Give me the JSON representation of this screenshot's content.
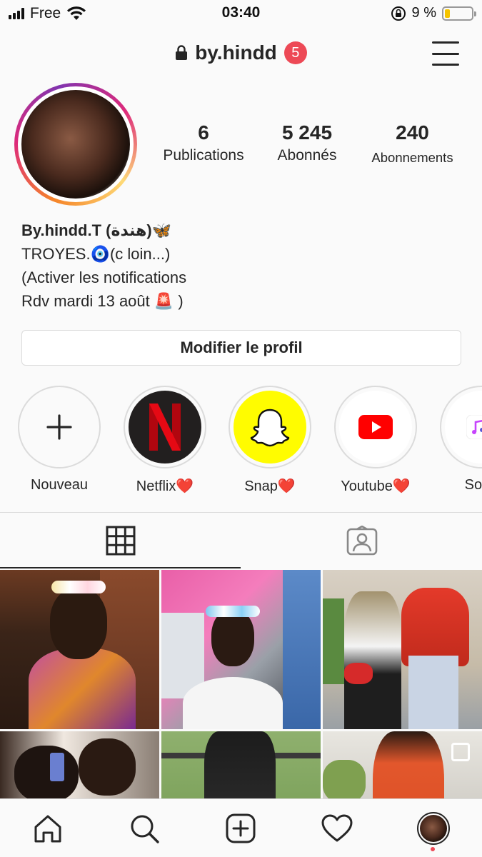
{
  "status_bar": {
    "carrier": "Free",
    "time": "03:40",
    "battery_percent": "9 %",
    "battery_level": 0.09,
    "icons": [
      "signal-icon",
      "wifi-icon",
      "rotation-lock-icon",
      "battery-icon"
    ]
  },
  "header": {
    "username": "by.hindd",
    "notification_count": "5",
    "icons": [
      "lock-icon",
      "menu-icon"
    ]
  },
  "profile": {
    "stats": [
      {
        "value": "6",
        "label": "Publications"
      },
      {
        "value": "5 245",
        "label": "Abonnés"
      },
      {
        "value": "240",
        "label": "Abonnements"
      }
    ],
    "bio": {
      "name": "By.hindd.T (هندة)🦋",
      "line1": "TROYES.🧿(c loin...)",
      "line2": "(Activer les notifications",
      "line3": "Rdv mardi 13 août 🚨 )"
    },
    "edit_button": "Modifier le profil"
  },
  "highlights": [
    {
      "label": "Nouveau",
      "icon": "plus-icon"
    },
    {
      "label": "Netflix❤️",
      "icon": "netflix-icon"
    },
    {
      "label": "Snap❤️",
      "icon": "snapchat-ghost-icon"
    },
    {
      "label": "Youtube❤️",
      "icon": "youtube-icon"
    },
    {
      "label": "Song",
      "icon": "music-note-icon"
    }
  ],
  "tabs": [
    {
      "name": "grid",
      "icon": "grid-icon",
      "active": true
    },
    {
      "name": "tagged",
      "icon": "tagged-person-icon",
      "active": false
    }
  ],
  "bottom_nav": [
    {
      "icon": "home-icon"
    },
    {
      "icon": "search-icon"
    },
    {
      "icon": "new-post-icon"
    },
    {
      "icon": "heart-icon"
    },
    {
      "icon": "profile-avatar"
    }
  ],
  "colors": {
    "accent_red": "#ed4956",
    "text": "#262626",
    "border": "#dbdbdb",
    "snap_yellow": "#fffc00",
    "netflix_red": "#e50914",
    "youtube_red": "#ff0000"
  }
}
